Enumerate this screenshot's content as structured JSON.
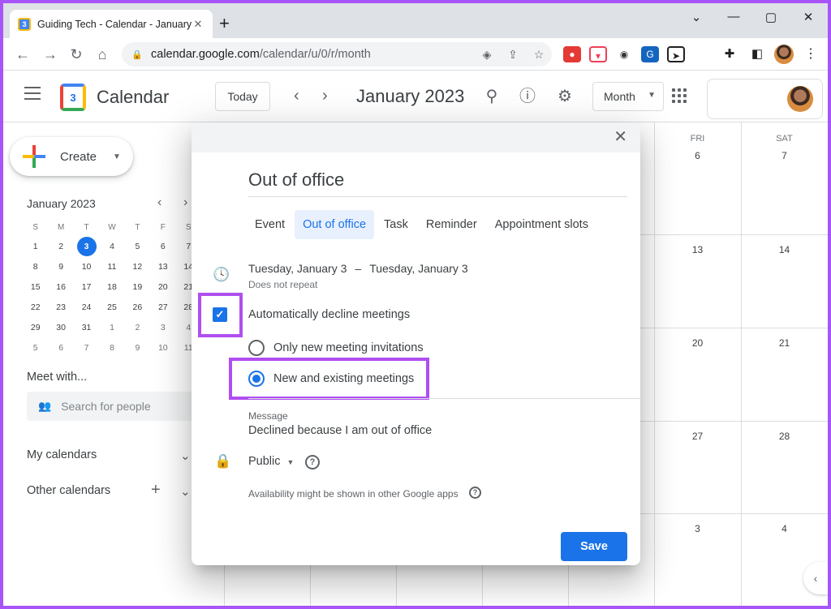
{
  "browser": {
    "tab_title": "Guiding Tech - Calendar - January",
    "tab_favicon_text": "3",
    "url_host": "calendar.google.com",
    "url_path": "/calendar/u/0/r/month"
  },
  "header": {
    "app_name": "Calendar",
    "logo_number": "3",
    "today_label": "Today",
    "month_title": "January 2023",
    "view_label": "Month"
  },
  "sidebar": {
    "create_label": "Create",
    "mini_title": "January 2023",
    "dow": [
      "S",
      "M",
      "T",
      "W",
      "T",
      "F",
      "S"
    ],
    "weeks": [
      [
        "1",
        "2",
        "3",
        "4",
        "5",
        "6",
        "7"
      ],
      [
        "8",
        "9",
        "10",
        "11",
        "12",
        "13",
        "14"
      ],
      [
        "15",
        "16",
        "17",
        "18",
        "19",
        "20",
        "21"
      ],
      [
        "22",
        "23",
        "24",
        "25",
        "26",
        "27",
        "28"
      ],
      [
        "29",
        "30",
        "31",
        "1",
        "2",
        "3",
        "4"
      ],
      [
        "5",
        "6",
        "7",
        "8",
        "9",
        "10",
        "11"
      ]
    ],
    "meet_with": "Meet with...",
    "search_people_placeholder": "Search for people",
    "my_calendars": "My calendars",
    "other_calendars": "Other calendars"
  },
  "month": {
    "day_headers": [
      "FRI",
      "SAT"
    ],
    "fri_dates": [
      "6",
      "13",
      "20",
      "27",
      "3"
    ],
    "sat_dates": [
      "7",
      "14",
      "21",
      "28",
      "4"
    ]
  },
  "dialog": {
    "title": "Out of office",
    "tabs": [
      "Event",
      "Out of office",
      "Task",
      "Reminder",
      "Appointment slots"
    ],
    "active_tab": "Out of office",
    "start_date": "Tuesday, January 3",
    "date_separator": "–",
    "end_date": "Tuesday, January 3",
    "repeat": "Does not repeat",
    "decline_label": "Automatically decline meetings",
    "decline_checked": true,
    "option_new": "Only new meeting invitations",
    "option_all": "New and existing meetings",
    "selected_option": "New and existing meetings",
    "message_caption": "Message",
    "message_value": "Declined because I am out of office",
    "visibility": "Public",
    "availability_note": "Availability might be shown in other Google apps",
    "save_label": "Save"
  },
  "colors": {
    "accent": "#1a73e8",
    "highlight": "#b04ef0"
  }
}
